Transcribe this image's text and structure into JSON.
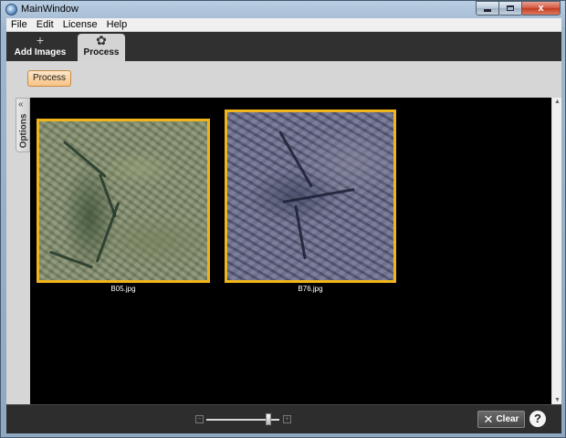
{
  "window": {
    "title": "MainWindow",
    "icon": "app-globe-icon",
    "controls": {
      "minimize": "minimize-icon",
      "maximize": "maximize-icon",
      "close": "x"
    }
  },
  "menu": {
    "items": [
      "File",
      "Edit",
      "License",
      "Help"
    ]
  },
  "tabs": {
    "add_icon": "+",
    "add_label": "Add Images",
    "process_icon": "✿",
    "process_label": "Process"
  },
  "toolbar": {
    "process_button": "Process"
  },
  "options_panel": {
    "label": "Options",
    "chevron": "«"
  },
  "gallery": {
    "images": [
      {
        "caption": "B05.jpg",
        "selected": true
      },
      {
        "caption": "B76.jpg",
        "selected": true
      }
    ],
    "selection_color": "#f1b51c"
  },
  "zoom": {
    "minus": "−",
    "plus": "+",
    "level": 0.85
  },
  "bottom_bar": {
    "clear_icon": "✕",
    "clear_label": "Clear",
    "help_label": "?"
  }
}
